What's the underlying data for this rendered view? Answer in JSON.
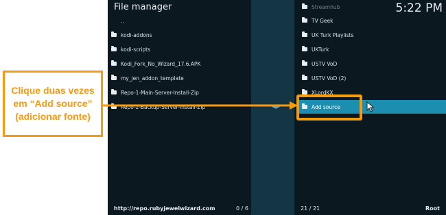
{
  "window": {
    "title": "File manager",
    "clock": "5:22 PM"
  },
  "left_list": [
    {
      "label": "..",
      "type": "parent"
    },
    {
      "label": "kodi-addons",
      "type": "folder"
    },
    {
      "label": "kodi-scripts",
      "type": "folder"
    },
    {
      "label": "Kodi_Fork_No_Wizard_17.6.APK",
      "type": "folder"
    },
    {
      "label": "my_jen_addon_template",
      "type": "folder"
    },
    {
      "label": "Repo-1-Main-Server-Install-Zip",
      "type": "folder"
    },
    {
      "label": "Repo-2-Backup-Server-Install-Zip",
      "type": "folder"
    }
  ],
  "right_list": [
    {
      "label": "Streamhub",
      "type": "folder",
      "state": "dim"
    },
    {
      "label": "TV Geek",
      "type": "folder"
    },
    {
      "label": "UK Turk Playlists",
      "type": "folder"
    },
    {
      "label": "UKTurk",
      "type": "folder"
    },
    {
      "label": "USTV VoD",
      "type": "folder"
    },
    {
      "label": "USTV VoD (2)",
      "type": "folder"
    },
    {
      "label": "XLordKX",
      "type": "folder"
    },
    {
      "label": "Add source",
      "type": "folder",
      "state": "selected"
    }
  ],
  "footer": {
    "path": "http://repo.rubyjewelwizard.com",
    "left_count": "0 / 6",
    "right_count": "21 / 21",
    "right_path": "Root"
  },
  "annotation": {
    "text": "Clique duas vezes em “Add source” (adicionar fonte)",
    "color": "#f39c12"
  }
}
